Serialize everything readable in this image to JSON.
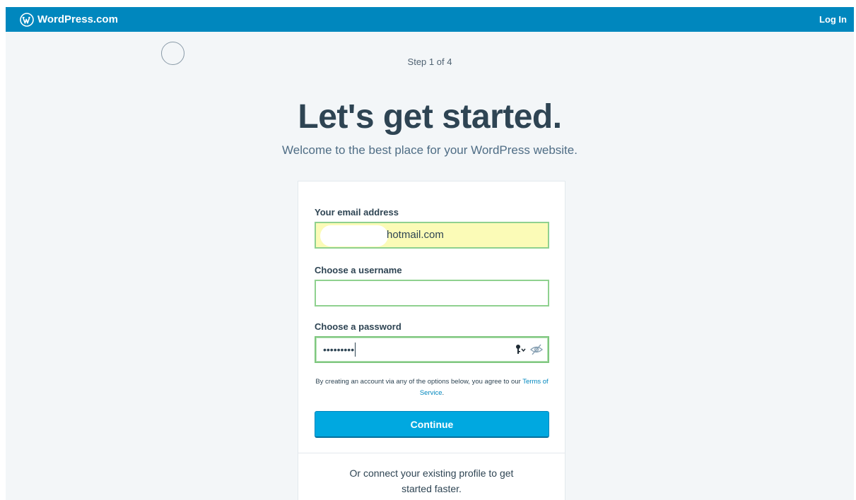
{
  "masterbar": {
    "brand": "WordPress.com",
    "brand_icon": "wordpress-logo-icon",
    "login_label": "Log In",
    "color": "#0087be"
  },
  "signup": {
    "step": "Step 1 of 4",
    "headline": "Let's get started.",
    "subhead": "Welcome to the best place for your WordPress website."
  },
  "form": {
    "email_label": "Your email address",
    "email_value_visible": "hotmail.com",
    "username_label": "Choose a username",
    "username_value": "",
    "password_label": "Choose a password",
    "password_value": "•••••••••",
    "password_icons": [
      "key-icon",
      "eye-slash-icon"
    ],
    "terms_prefix": "By creating an account via any of the options below, you agree to our",
    "terms_link": "Terms of Service",
    "terms_suffix": ".",
    "continue_label": "Continue",
    "continue_color": "#00a8e0"
  },
  "connect": {
    "line1": "Or connect your existing profile to get",
    "line2": "started faster."
  }
}
